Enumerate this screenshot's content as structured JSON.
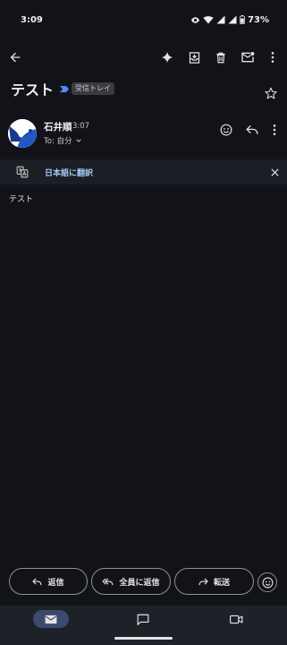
{
  "status_bar": {
    "time": "3:09",
    "battery": "73%"
  },
  "toolbar": {
    "back_icon": "arrow-left-icon",
    "actions": [
      "sparkle-icon",
      "archive-icon",
      "delete-icon",
      "mark-unread-icon",
      "more-vert-icon"
    ]
  },
  "message": {
    "subject": "テスト",
    "label": "受信トレイ",
    "sender_name": "石井順",
    "time": "3:07",
    "recipient": "To: 自分",
    "translate_text": "日本語に翻訳",
    "body": "テスト"
  },
  "actions": {
    "reply": "返信",
    "reply_all": "全員に返信",
    "forward": "転送"
  },
  "colors": {
    "background": "#111318",
    "accent": "#a8c7fa",
    "translate_bar": "#1b1e25",
    "nav_active": "#3c4a6e"
  }
}
